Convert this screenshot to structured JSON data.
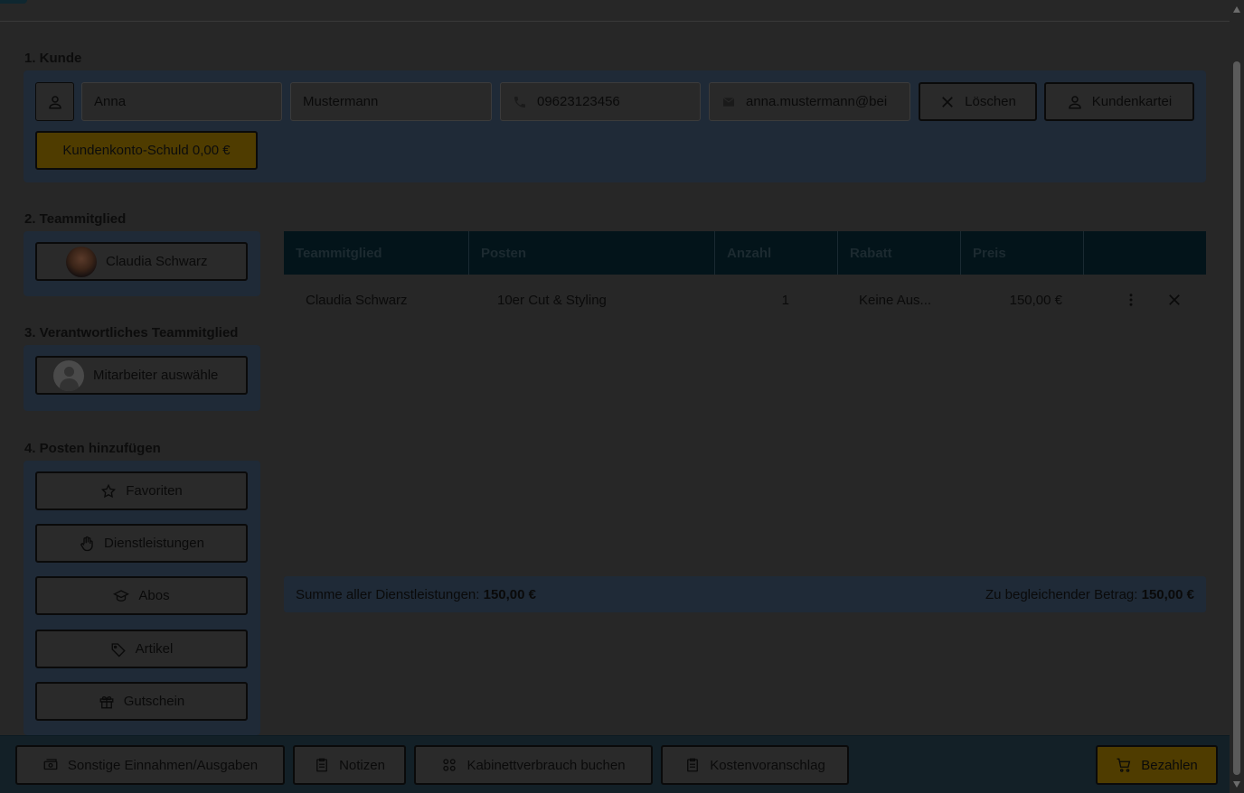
{
  "customer": {
    "section_title": "1. Kunde",
    "first_name": "Anna",
    "last_name": "Mustermann",
    "phone": "09623123456",
    "email": "anna.mustermann@bei",
    "delete_label": "Löschen",
    "card_label": "Kundenkartei",
    "debt_label": "Kundenkonto-Schuld 0,00 €"
  },
  "team": {
    "section_title": "2. Teammitglied",
    "member_name": "Claudia Schwarz"
  },
  "responsible": {
    "section_title": "3. Verantwortliches Teammitglied",
    "placeholder": "Mitarbeiter auswähle"
  },
  "add_items": {
    "section_title": "4. Posten hinzufügen",
    "buttons": [
      {
        "label": "Favoriten",
        "icon": "star-icon"
      },
      {
        "label": "Dienstleistungen",
        "icon": "hand-icon"
      },
      {
        "label": "Abos",
        "icon": "graduation-cap-icon"
      },
      {
        "label": "Artikel",
        "icon": "tag-icon"
      },
      {
        "label": "Gutschein",
        "icon": "gift-icon"
      }
    ]
  },
  "table": {
    "columns": [
      "Teammitglied",
      "Posten",
      "Anzahl",
      "Rabatt",
      "Preis"
    ],
    "rows": [
      {
        "member": "Claudia Schwarz",
        "item": "10er Cut & Styling",
        "quantity": "1",
        "discount": "Keine Aus...",
        "price": "150,00 €"
      }
    ]
  },
  "summary": {
    "services_label": "Summe aller Dienstleistungen:",
    "services_total": "150,00 €",
    "due_label": "Zu begleichender Betrag:",
    "due_total": "150,00 €"
  },
  "footer": {
    "other_label": "Sonstige Einnahmen/Ausgaben",
    "notes_label": "Notizen",
    "cabinet_label": "Kabinettverbrauch buchen",
    "estimate_label": "Kostenvoranschlag",
    "pay_label": "Bezahlen"
  }
}
